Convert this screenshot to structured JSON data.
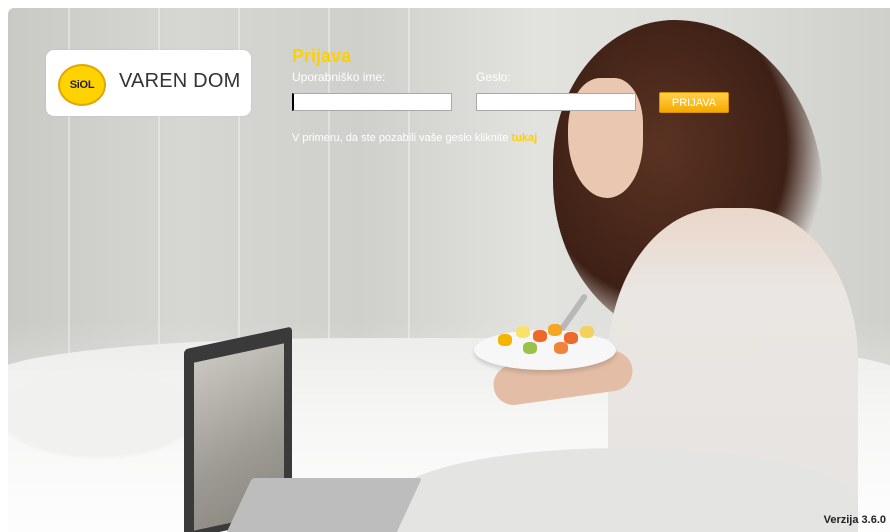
{
  "logo": {
    "badge_text": "SiOL",
    "brand_text": "VAREN DOM",
    "badge_color": "#ffd200"
  },
  "login": {
    "title": "Prijava",
    "username_label": "Uporabniško ime:",
    "username_value": "",
    "password_label": "Geslo:",
    "password_value": "",
    "submit_label": "PRIJAVA",
    "forgot_text": "V primeru, da ste pozabili vaše geslo kliknite",
    "forgot_link": "tukaj",
    "accent_color": "#ffd000"
  },
  "footer": {
    "version": "Verzija 3.6.0"
  }
}
